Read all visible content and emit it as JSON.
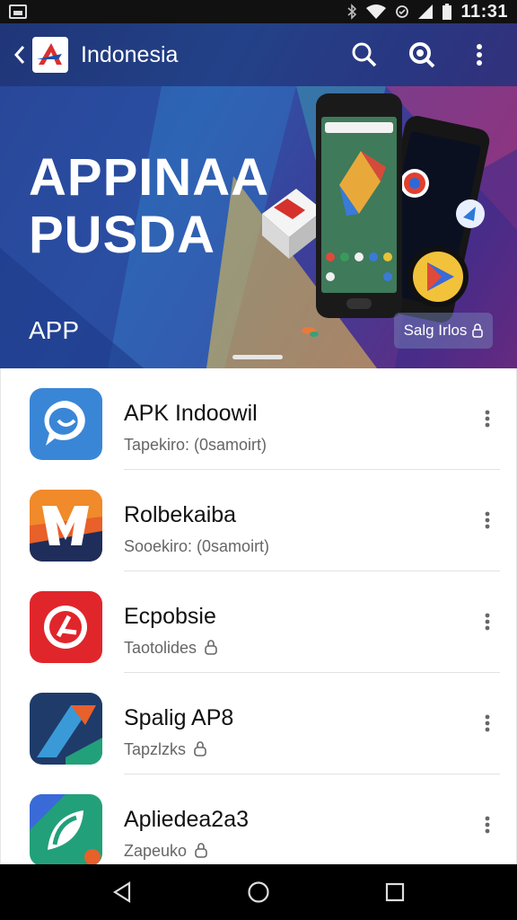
{
  "status_bar": {
    "time": "11:31"
  },
  "appbar": {
    "title": "Indonesia",
    "icons": [
      "back-icon",
      "app-logo-icon",
      "search-icon",
      "search-settings-icon",
      "more-vert-icon"
    ]
  },
  "hero": {
    "title_line1": "APPINAA",
    "title_line2": "PUSDA",
    "subtitle": "APP",
    "chip_label": "Salg Irlos"
  },
  "apps": [
    {
      "name": "APK Indoowil",
      "subtitle": "Tapekiro: (0samoirt)",
      "icon": "chat-bubble-icon",
      "color": "#3a86d6"
    },
    {
      "name": "Rolbekaiba",
      "subtitle": "Sooekiro: (0samoirt)",
      "icon": "m-logo-icon",
      "color": "#e8602a"
    },
    {
      "name": "Ecpobsie",
      "subtitle": "Taotolides",
      "icon": "e-logo-icon",
      "color": "#e0262b"
    },
    {
      "name": "Spalig AP8",
      "subtitle": "Tapzlzks",
      "icon": "arrow-logo-icon",
      "color": "#1f3b6a"
    },
    {
      "name": "Apliedea2a3",
      "subtitle": "Zapeuko",
      "icon": "leaf-logo-icon",
      "color": "#22a07a"
    }
  ],
  "nav": {
    "icons": [
      "back-triangle-icon",
      "home-circle-icon",
      "recents-square-icon"
    ]
  }
}
